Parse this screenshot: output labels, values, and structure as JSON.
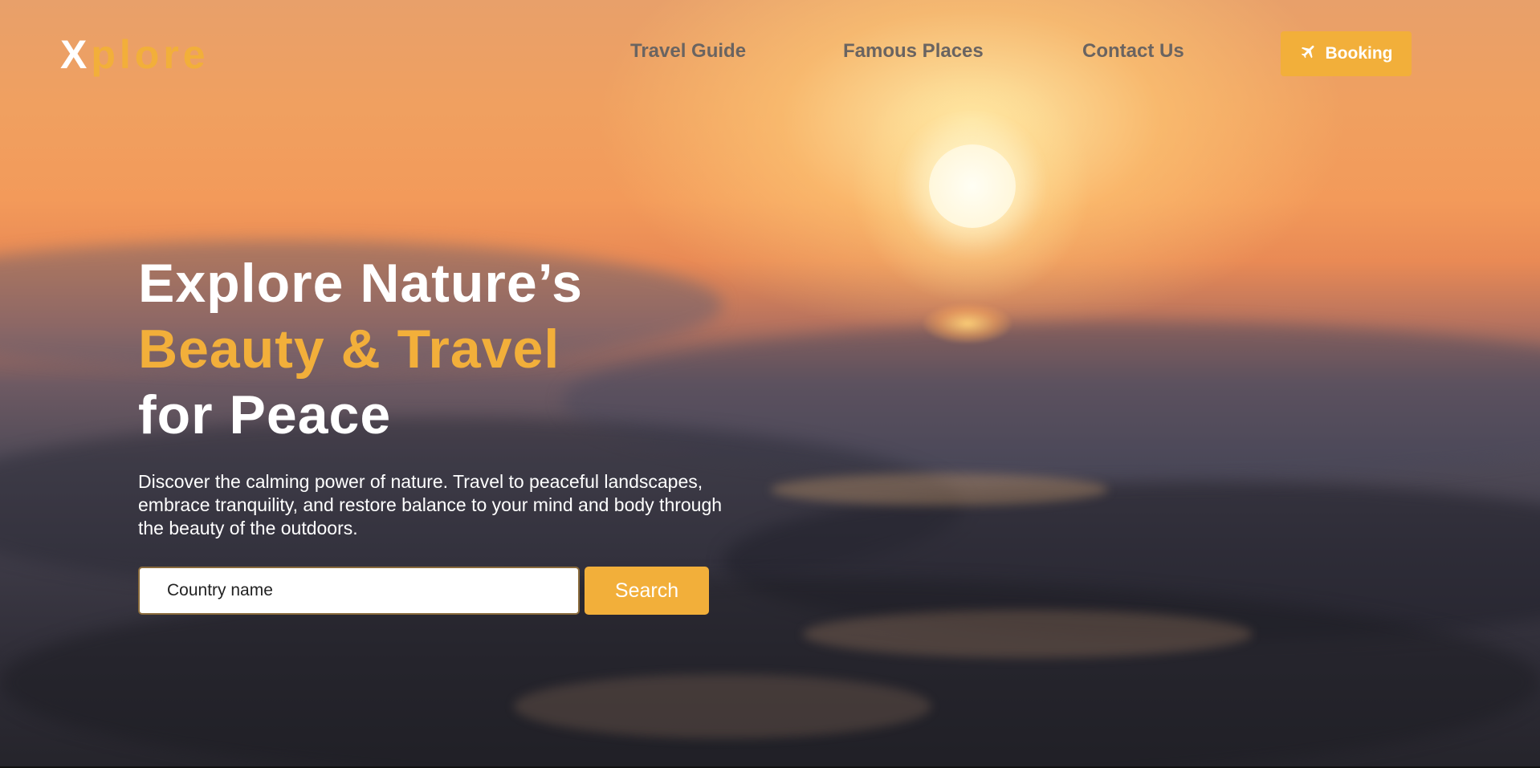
{
  "header": {
    "logo_first": "X",
    "logo_rest": "plore",
    "nav": [
      "Travel Guide",
      "Famous Places",
      "Contact Us"
    ],
    "booking_label": "Booking",
    "booking_icon": "airplane-icon"
  },
  "hero": {
    "line1": "Explore Nature’s",
    "line2": "Beauty & Travel",
    "line3": "for Peace",
    "description": "Discover the calming power of nature. Travel to peaceful landscapes, embrace tranquility, and restore balance to your mind and body through the beauty of the outdoors."
  },
  "search": {
    "placeholder": "Country name",
    "button_label": "Search"
  },
  "colors": {
    "accent": "#f2af3a",
    "nav_text": "#6a6461",
    "headline_white": "#ffffff"
  }
}
